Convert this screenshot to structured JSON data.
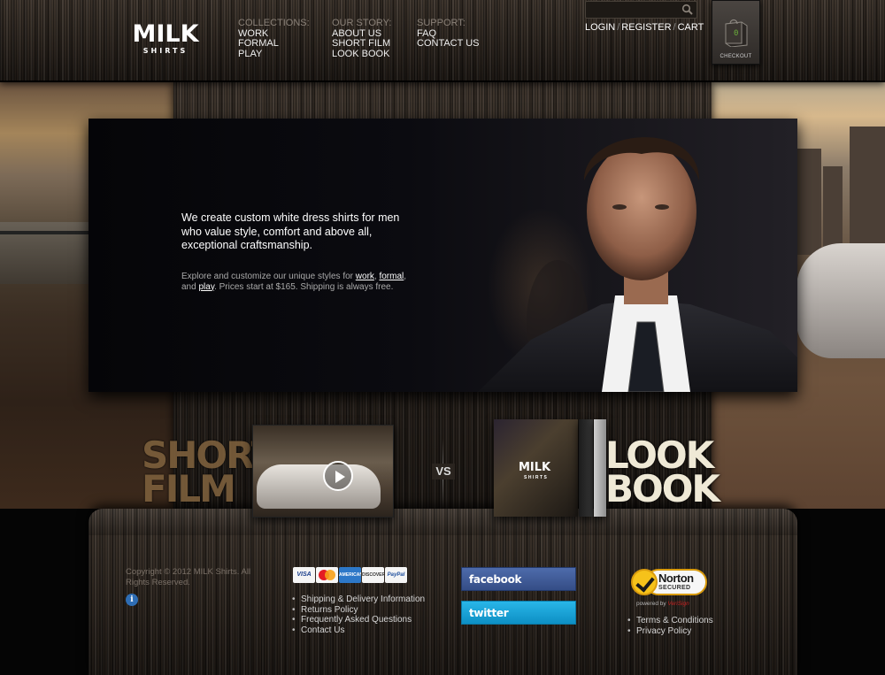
{
  "brand": {
    "logo_big": "MILK",
    "logo_small": "SHIRTS"
  },
  "nav": {
    "collections": {
      "heading": "COLLECTIONS:",
      "items": [
        "WORK",
        "FORMAL",
        "PLAY"
      ]
    },
    "story": {
      "heading": "OUR STORY:",
      "items": [
        "ABOUT US",
        "SHORT FILM",
        "LOOK BOOK"
      ]
    },
    "support": {
      "heading": "SUPPORT:",
      "items": [
        "FAQ",
        "CONTACT US"
      ]
    }
  },
  "search": {
    "placeholder": ""
  },
  "account": {
    "login": "LOGIN",
    "register": "REGISTER",
    "cart": "CART",
    "separator": "/"
  },
  "checkout": {
    "count": "0",
    "label": "CHECKOUT"
  },
  "hero": {
    "headline": "We create custom white dress shirts for men who value style, comfort and above all, exceptional craftsmanship.",
    "sub_prefix": "Explore and customize our unique styles for ",
    "link_work": "work",
    "link_formal": "formal",
    "sub_and": "and ",
    "link_play": "play",
    "sub_suffix": ". Prices start at $165. Shipping is always free."
  },
  "promos": {
    "short_film": {
      "line1": "SHORT",
      "line2": "FILM"
    },
    "vs": "VS",
    "look_book": {
      "line1": "LOOK",
      "line2": "BOOK",
      "cover_logo": "MILK",
      "cover_small": "SHIRTS"
    }
  },
  "footer": {
    "copyright": "Copyright © 2012 MILK Shirts. All Rights Reserved.",
    "info": "i",
    "payment_cards": {
      "visa": "VISA",
      "amex": "AMERICAN EXPRESS",
      "discover": "DISCOVER",
      "paypal": "PayPal"
    },
    "links": [
      "Shipping & Delivery Information",
      "Returns Policy",
      "Frequently Asked Questions",
      "Contact Us"
    ],
    "facebook": "facebook",
    "twitter": "twitter",
    "norton": {
      "name": "Norton",
      "secured": "SECURED",
      "powered_by": "powered by ",
      "provider": "VeriSign"
    },
    "legal_links": [
      "Terms & Conditions",
      "Privacy Policy"
    ]
  },
  "colors": {
    "accent_link": "#ffffff",
    "nav_heading": "#8a8178",
    "facebook_blue": "#3b5998",
    "twitter_blue": "#1da1db",
    "norton_yellow": "#f6c21a"
  }
}
